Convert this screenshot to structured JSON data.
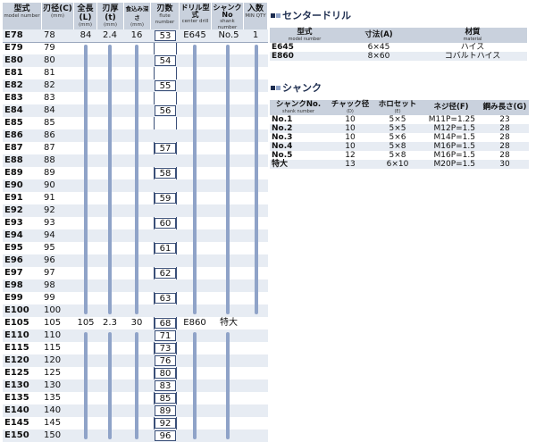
{
  "main_table": {
    "headers": [
      {
        "jp": "型式",
        "en": "model number"
      },
      {
        "jp": "刃径(C)",
        "en": "(mm)"
      },
      {
        "jp": "全長(L)",
        "en": "(mm)"
      },
      {
        "jp": "刃厚(t)",
        "en": "(mm)"
      },
      {
        "jp": "食込み深さ",
        "en": "(mm)"
      },
      {
        "jp": "刃数",
        "en": "flute number"
      },
      {
        "jp": "ドリル型式",
        "en": "center drill"
      },
      {
        "jp": "シャンクNo",
        "en": "shank number"
      },
      {
        "jp": "入数",
        "en": "MIN QTY"
      }
    ],
    "rows": [
      {
        "model": "E78",
        "bore": "78",
        "length": "84",
        "thickness": "2.4",
        "bite": "16",
        "flutes": "53",
        "drill": "E645",
        "shank": "No.5",
        "qty": "1"
      },
      {
        "model": "E79",
        "bore": "79"
      },
      {
        "model": "E80",
        "bore": "80",
        "flutes": "54"
      },
      {
        "model": "E81",
        "bore": "81"
      },
      {
        "model": "E82",
        "bore": "82",
        "flutes": "55"
      },
      {
        "model": "E83",
        "bore": "83"
      },
      {
        "model": "E84",
        "bore": "84",
        "flutes": "56"
      },
      {
        "model": "E85",
        "bore": "85"
      },
      {
        "model": "E86",
        "bore": "86"
      },
      {
        "model": "E87",
        "bore": "87",
        "flutes": "57"
      },
      {
        "model": "E88",
        "bore": "88"
      },
      {
        "model": "E89",
        "bore": "89",
        "flutes": "58"
      },
      {
        "model": "E90",
        "bore": "90"
      },
      {
        "model": "E91",
        "bore": "91",
        "flutes": "59"
      },
      {
        "model": "E92",
        "bore": "92"
      },
      {
        "model": "E93",
        "bore": "93",
        "flutes": "60"
      },
      {
        "model": "E94",
        "bore": "94"
      },
      {
        "model": "E95",
        "bore": "95",
        "flutes": "61"
      },
      {
        "model": "E96",
        "bore": "96"
      },
      {
        "model": "E97",
        "bore": "97",
        "flutes": "62"
      },
      {
        "model": "E98",
        "bore": "98"
      },
      {
        "model": "E99",
        "bore": "99",
        "flutes": "63"
      },
      {
        "model": "E100",
        "bore": "100"
      },
      {
        "model": "E105",
        "bore": "105",
        "length": "105",
        "thickness": "2.3",
        "bite": "30",
        "flutes": "68",
        "drill": "E860",
        "shank": "特大"
      },
      {
        "model": "E110",
        "bore": "110",
        "flutes": "71"
      },
      {
        "model": "E115",
        "bore": "115",
        "flutes": "73"
      },
      {
        "model": "E120",
        "bore": "120",
        "flutes": "76"
      },
      {
        "model": "E125",
        "bore": "125",
        "flutes": "80"
      },
      {
        "model": "E130",
        "bore": "130",
        "flutes": "83"
      },
      {
        "model": "E135",
        "bore": "135",
        "flutes": "85"
      },
      {
        "model": "E140",
        "bore": "140",
        "flutes": "89"
      },
      {
        "model": "E145",
        "bore": "145",
        "flutes": "92"
      },
      {
        "model": "E150",
        "bore": "150",
        "flutes": "96"
      }
    ]
  },
  "center_drill": {
    "title": "センタードリル",
    "headers": [
      {
        "jp": "型式",
        "en": "model number"
      },
      {
        "jp": "寸法(A)",
        "en": ""
      },
      {
        "jp": "材質",
        "en": "material"
      }
    ],
    "rows": [
      [
        "E645",
        "6×45",
        "ハイス"
      ],
      [
        "E860",
        "8×60",
        "コバルトハイス"
      ]
    ]
  },
  "shank": {
    "title": "シャンク",
    "headers": [
      {
        "jp": "シャンクNo.",
        "en": "shank number"
      },
      {
        "jp": "チャック径",
        "en": "(D)"
      },
      {
        "jp": "ホロセット",
        "en": "(E)"
      },
      {
        "jp": "ネジ径(F)",
        "en": ""
      },
      {
        "jp": "鋼み長さ(G)",
        "en": ""
      }
    ],
    "rows": [
      [
        "No.1",
        "10",
        "5×5",
        "M11P=1.25",
        "23"
      ],
      [
        "No.2",
        "10",
        "5×5",
        "M12P=1.5",
        "28"
      ],
      [
        "No.3",
        "10",
        "5×6",
        "M14P=1.5",
        "28"
      ],
      [
        "No.4",
        "10",
        "5×8",
        "M16P=1.5",
        "28"
      ],
      [
        "No.5",
        "12",
        "5×8",
        "M16P=1.5",
        "28"
      ],
      [
        "特大",
        "13",
        "6×10",
        "M20P=1.5",
        "30"
      ]
    ]
  },
  "colors": {
    "header_bg": "#c9d1dd",
    "row_shade": "#e7ecf3",
    "bar": "#8fa3c8",
    "title": "#1d2d4f"
  }
}
